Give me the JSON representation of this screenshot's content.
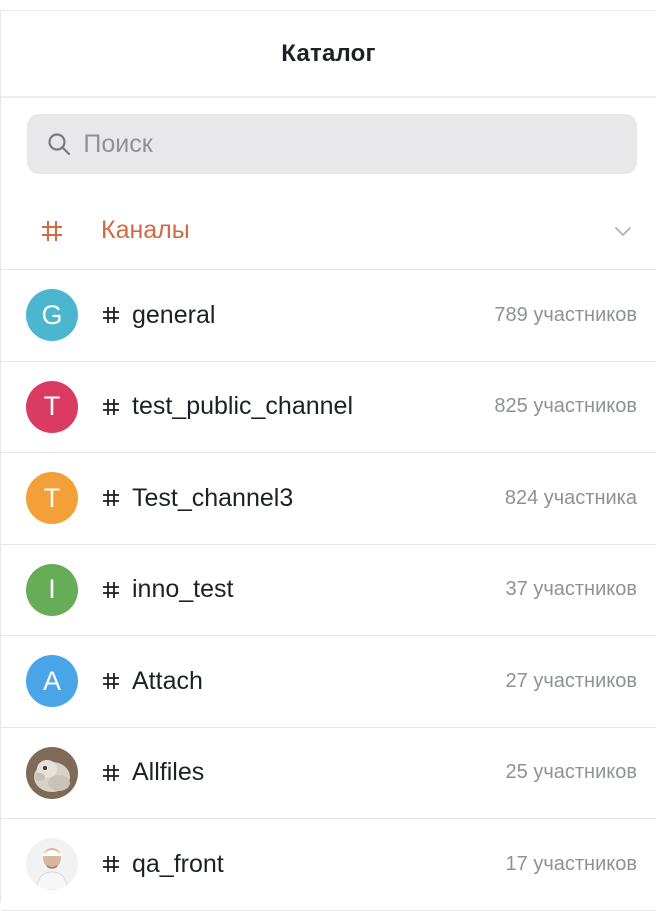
{
  "header": {
    "title": "Каталог"
  },
  "search": {
    "placeholder": "Поиск",
    "value": ""
  },
  "section": {
    "label": "Каналы",
    "accent": "#cf6a43"
  },
  "channels": [
    {
      "initial": "G",
      "avatar_color": "#4cb6cf",
      "avatar_type": "letter",
      "name": "general",
      "members": "789 участников"
    },
    {
      "initial": "T",
      "avatar_color": "#d93b63",
      "avatar_type": "letter",
      "name": "test_public_channel",
      "members": "825 участников"
    },
    {
      "initial": "T",
      "avatar_color": "#f3a038",
      "avatar_type": "letter",
      "name": "Test_channel3",
      "members": "824 участника"
    },
    {
      "initial": "I",
      "avatar_color": "#67ad57",
      "avatar_type": "letter",
      "name": "inno_test",
      "members": "37 участников"
    },
    {
      "initial": "A",
      "avatar_color": "#4aa5e8",
      "avatar_type": "letter",
      "name": "Attach",
      "members": "27 участников"
    },
    {
      "initial": "",
      "avatar_color": "#8d7a67",
      "avatar_type": "photo-dog",
      "name": "Allfiles",
      "members": "25 участников"
    },
    {
      "initial": "",
      "avatar_color": "#e9e9e9",
      "avatar_type": "photo-person",
      "name": "qa_front",
      "members": "17 участников"
    }
  ],
  "icons": {
    "search": "search-icon",
    "section": "hash-icon",
    "chevron": "chevron-down-icon",
    "channel_hash": "hash-icon"
  }
}
